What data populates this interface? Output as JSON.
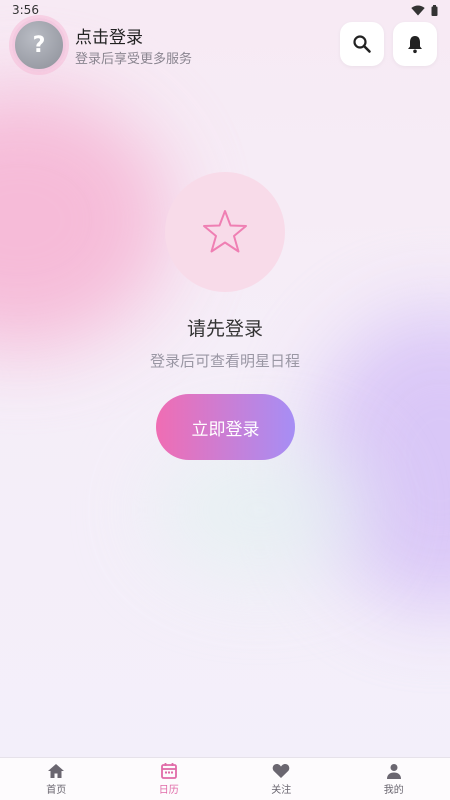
{
  "status_bar": {
    "time": "3:56"
  },
  "header": {
    "avatar_text": "?",
    "title": "点击登录",
    "subtitle": "登录后享受更多服务"
  },
  "main": {
    "title": "请先登录",
    "subtitle": "登录后可查看明星日程",
    "login_button": "立即登录"
  },
  "tabs": [
    {
      "label": "首页",
      "icon": "home-icon"
    },
    {
      "label": "日历",
      "icon": "calendar-icon",
      "active": true
    },
    {
      "label": "关注",
      "icon": "heart-icon"
    },
    {
      "label": "我的",
      "icon": "person-icon"
    }
  ],
  "colors": {
    "accent_pink": "#f06db3",
    "accent_purple": "#a68ef5",
    "active_tab": "#e06aa8",
    "inactive_tab": "#6a6670"
  }
}
